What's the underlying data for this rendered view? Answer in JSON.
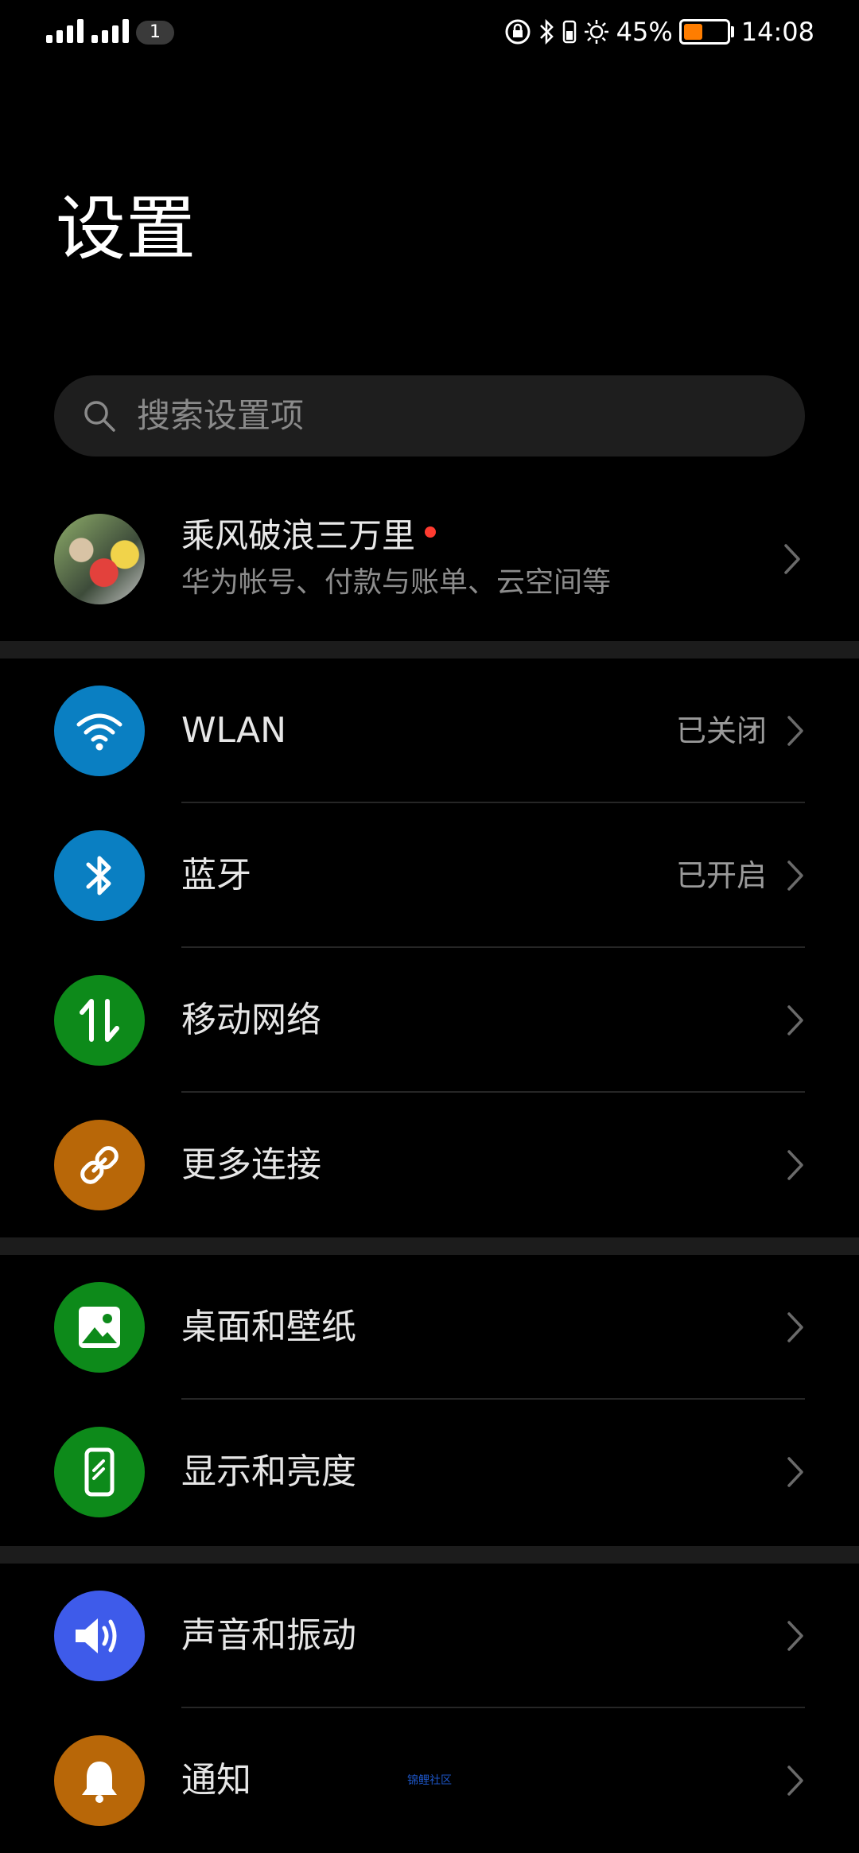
{
  "status_bar": {
    "sim_badge": "1",
    "battery_percent": "45%",
    "battery_level": 0.45,
    "battery_color": "#ff7d00",
    "time": "14:08",
    "icons": [
      "signal-icon",
      "signal-icon",
      "rotation-lock-icon",
      "bluetooth-icon",
      "vibrate-icon",
      "brightness-icon",
      "battery-icon"
    ]
  },
  "page": {
    "title": "设置"
  },
  "search": {
    "placeholder": "搜索设置项"
  },
  "account": {
    "name": "乘风破浪三万里",
    "subtitle": "华为帐号、付款与账单、云空间等"
  },
  "settings": [
    {
      "label": "WLAN",
      "value": "已关闭",
      "icon": "wifi-icon",
      "color": "#0a7fc2"
    },
    {
      "label": "蓝牙",
      "value": "已开启",
      "icon": "bluetooth-icon",
      "color": "#0a7fc2"
    },
    {
      "label": "移动网络",
      "value": "",
      "icon": "mobile-data-icon",
      "color": "#0d8a1a"
    },
    {
      "label": "更多连接",
      "value": "",
      "icon": "link-icon",
      "color": "#b86708"
    },
    {
      "label": "桌面和壁纸",
      "value": "",
      "icon": "image-icon",
      "color": "#0d8a1a"
    },
    {
      "label": "显示和亮度",
      "value": "",
      "icon": "display-icon",
      "color": "#0d8a1a"
    },
    {
      "label": "声音和振动",
      "value": "",
      "icon": "sound-icon",
      "color": "#3e5bea"
    },
    {
      "label": "通知",
      "value": "",
      "icon": "bell-icon",
      "color": "#b86708"
    }
  ],
  "watermark": "锦鲤社区"
}
